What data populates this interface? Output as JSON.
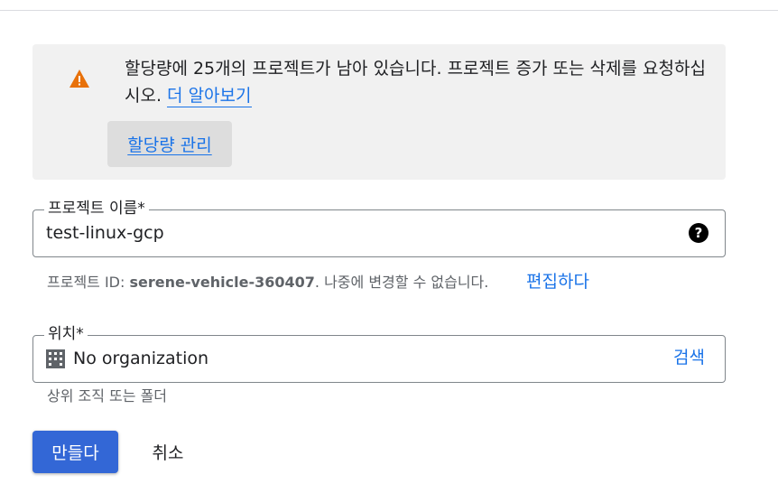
{
  "quota": {
    "message": "할당량에 25개의 프로젝트가 남아 있습니다. 프로젝트 증가 또는 삭제를 요청하십시오.",
    "learn_more": "더 알아보기",
    "manage_button": "할당량 관리",
    "icon": "warning-icon",
    "icon_color": "#e8710a"
  },
  "project_name": {
    "label": "프로젝트 이름*",
    "value": "test-linux-gcp",
    "help_icon": "help-icon"
  },
  "project_id": {
    "prefix": "프로젝트 ID: ",
    "id": "serene-vehicle-360407",
    "suffix": ". 나중에 변경할 수 없습니다.",
    "edit_link": "편집하다"
  },
  "location": {
    "label": "위치*",
    "value": "No organization",
    "browse_link": "검색",
    "icon": "organization-icon",
    "hint": "상위 조직 또는 폴더"
  },
  "actions": {
    "create": "만들다",
    "cancel": "취소"
  },
  "colors": {
    "accent": "#1a73e8",
    "primary_button": "#3367d6"
  }
}
